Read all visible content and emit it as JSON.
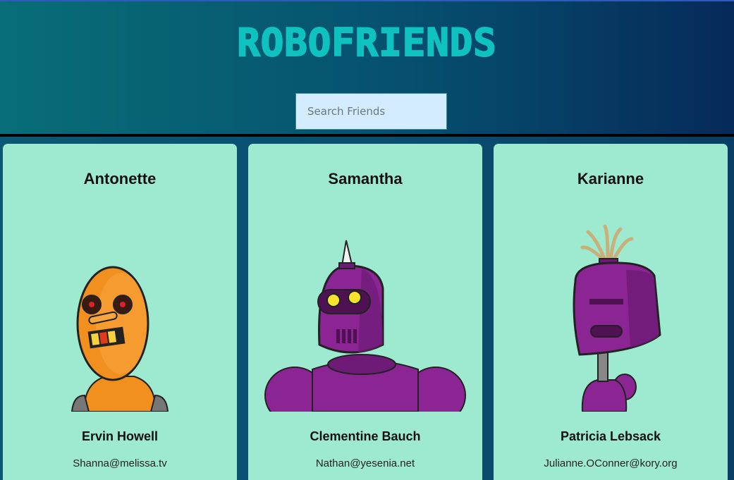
{
  "app": {
    "title": "ROBOFRIENDS"
  },
  "search": {
    "placeholder": "Search Friends",
    "value": ""
  },
  "cards": [
    {
      "username": "Antonette",
      "name": "Ervin Howell",
      "email": "Shanna@melissa.tv",
      "robot_color": "#f2901f"
    },
    {
      "username": "Samantha",
      "name": "Clementine Bauch",
      "email": "Nathan@yesenia.net",
      "robot_color": "#8a2593"
    },
    {
      "username": "Karianne",
      "name": "Patricia Lebsack",
      "email": "Julianne.OConner@kory.org",
      "robot_color": "#8a2593"
    }
  ]
}
